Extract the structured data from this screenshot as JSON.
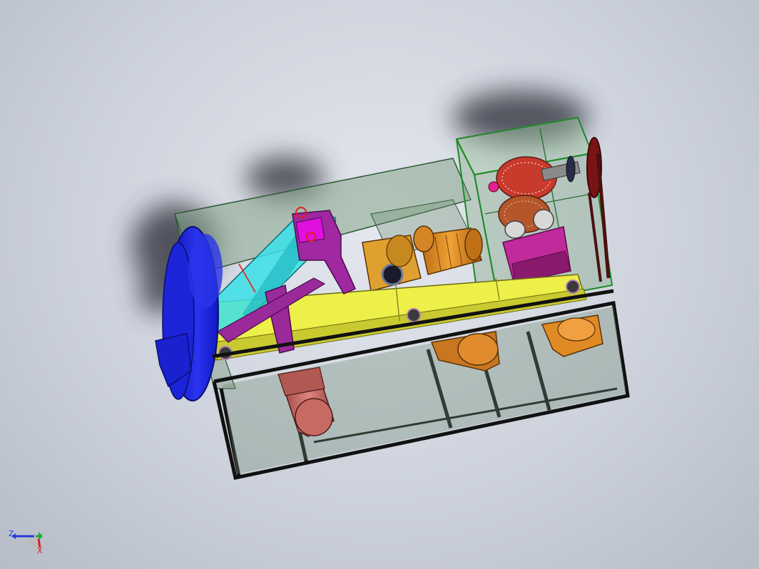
{
  "viewport": {
    "background_top": "#e4e7ee",
    "background_bottom": "#b6bcc8"
  },
  "model": {
    "frame_color": "#111111",
    "guard_color": "#3e7a48",
    "conveyor_color": "#f0f24a",
    "fan_color": "#1a22d8",
    "motor_color": "#e08a1e",
    "arm_color": "#34e0e8",
    "bracket_color": "#a0208c",
    "pump_motor_color": "#cc6a66"
  },
  "triad": {
    "z_label": "Z",
    "x_label": "X",
    "z_color": "#2a3ad8",
    "y_color": "#1ea83a",
    "x_color": "#d82020"
  }
}
